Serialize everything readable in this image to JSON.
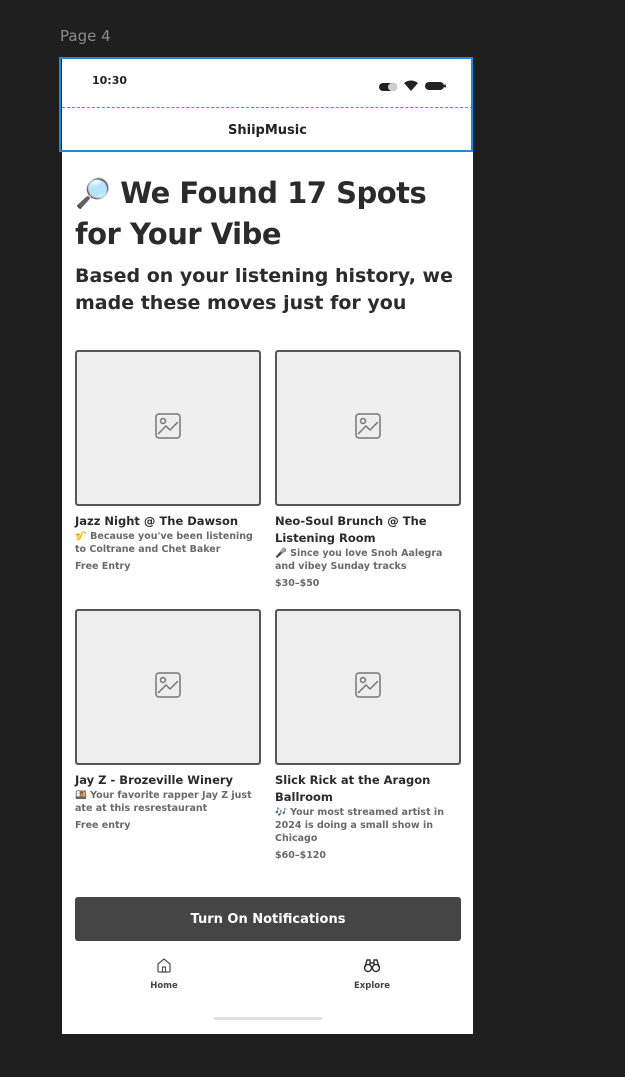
{
  "canvas": {
    "page_label": "Page 4"
  },
  "status_bar": {
    "time": "10:30"
  },
  "app_bar": {
    "title": "ShiipMusic"
  },
  "hero": {
    "headline_icon": "magnifying-glass-icon",
    "headline": "🔎 We Found 17 Spots for Your Vibe",
    "subhead": "Based on your listening history, we made these moves just for you"
  },
  "cards": [
    {
      "title": "Jazz Night @ The Dawson",
      "reason": "🎷 Because you've been listening to Coltrane and Chet Baker",
      "price": "Free Entry"
    },
    {
      "title": "Neo-Soul Brunch @ The Listening Room",
      "reason": "🎤 Since you love Snoh Aalegra and vibey Sunday tracks",
      "price": "$30–$50"
    },
    {
      "title": "Jay Z - Brozeville Winery",
      "reason": "🍱 Your favorite rapper Jay Z just ate at this resrestaurant",
      "price": "Free entry"
    },
    {
      "title": "Slick Rick at the Aragon Ballroom",
      "reason": "🎶 Your most streamed artist in 2024 is doing a small show in Chicago",
      "price": "$60–$120"
    }
  ],
  "cta": {
    "label": "Turn On Notifications"
  },
  "tab_bar": {
    "items": [
      {
        "label": "Home",
        "icon": "home-icon"
      },
      {
        "label": "Explore",
        "icon": "binoculars-icon"
      }
    ]
  },
  "colors": {
    "selection": "#1e88e5",
    "button_bg": "#454545",
    "placeholder_bg": "#eeeeee",
    "canvas_bg": "#1e1e1e"
  }
}
